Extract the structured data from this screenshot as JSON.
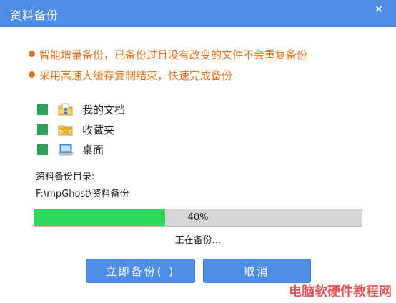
{
  "window": {
    "title": "资料备份",
    "close_glyph": "✕"
  },
  "notices": [
    "智能增量备份，已备份过且没有改变的文件不会重复备份",
    "采用高速大缓存复制结束，快速完成备份"
  ],
  "items": [
    {
      "label": "我的文档",
      "icon": "documents-folder-icon"
    },
    {
      "label": "收藏夹",
      "icon": "favorites-folder-icon"
    },
    {
      "label": "桌面",
      "icon": "desktop-icon"
    }
  ],
  "backup_dir": {
    "label": "资料备份目录:",
    "path": "F:\\mpGhost\\资料备份"
  },
  "progress": {
    "value": 0.4,
    "label": "40%"
  },
  "status": "正在备份...",
  "buttons": {
    "start": "立即备份( )",
    "cancel": "取消"
  },
  "watermark": "电脑软硬件教程网",
  "colors": {
    "titlebar": "#4f8ee6",
    "notice": "#e8731c",
    "progress_fill": "#2bd85c",
    "checkbox": "#2ba35a",
    "button": "#4f8ee6"
  }
}
